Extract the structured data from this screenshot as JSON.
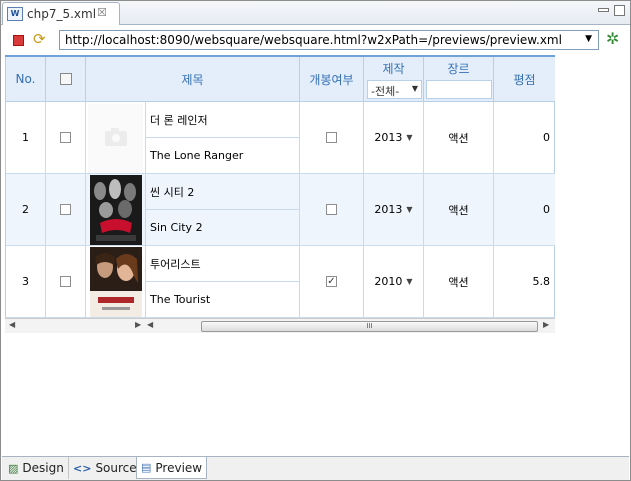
{
  "editor": {
    "tab_title": "chp7_5.xml",
    "tab_close": "☒",
    "tab_icon": "W"
  },
  "toolbar": {
    "url": "http://localhost:8090/websquare/websquare.html?w2xPath=/previews/preview.xml",
    "url_dropdown": "▼"
  },
  "grid": {
    "headers": {
      "no": "No.",
      "title": "제목",
      "released": "개봉여부",
      "production": "제작",
      "production_filter": "-전체-",
      "genre": "장르",
      "rating": "평점"
    },
    "rows": [
      {
        "no": "1",
        "checked": false,
        "title_ko": "더 론 레인저",
        "title_en": "The Lone Ranger",
        "released": false,
        "year": "2013",
        "genre": "액션",
        "rating": "0",
        "poster": "placeholder"
      },
      {
        "no": "2",
        "checked": false,
        "title_ko": "씬 시티 2",
        "title_en": "Sin City 2",
        "released": false,
        "year": "2013",
        "genre": "액션",
        "rating": "0",
        "poster": "sin-city"
      },
      {
        "no": "3",
        "checked": false,
        "title_ko": "투어리스트",
        "title_en": "The Tourist",
        "released": true,
        "year": "2010",
        "genre": "액션",
        "rating": "5.8",
        "poster": "tourist"
      }
    ],
    "scroll_thumb_grip": "III"
  },
  "bottom_tabs": [
    {
      "label": "Design",
      "icon": "design-icon",
      "active": false
    },
    {
      "label": "Source",
      "icon": "source-icon",
      "active": false
    },
    {
      "label": "Preview",
      "icon": "preview-icon",
      "active": true
    }
  ],
  "colors": {
    "header_bg": "#e4eefa",
    "header_text": "#3470b5",
    "alt_row": "#eef5fd",
    "grid_border": "#b8cfe8"
  }
}
